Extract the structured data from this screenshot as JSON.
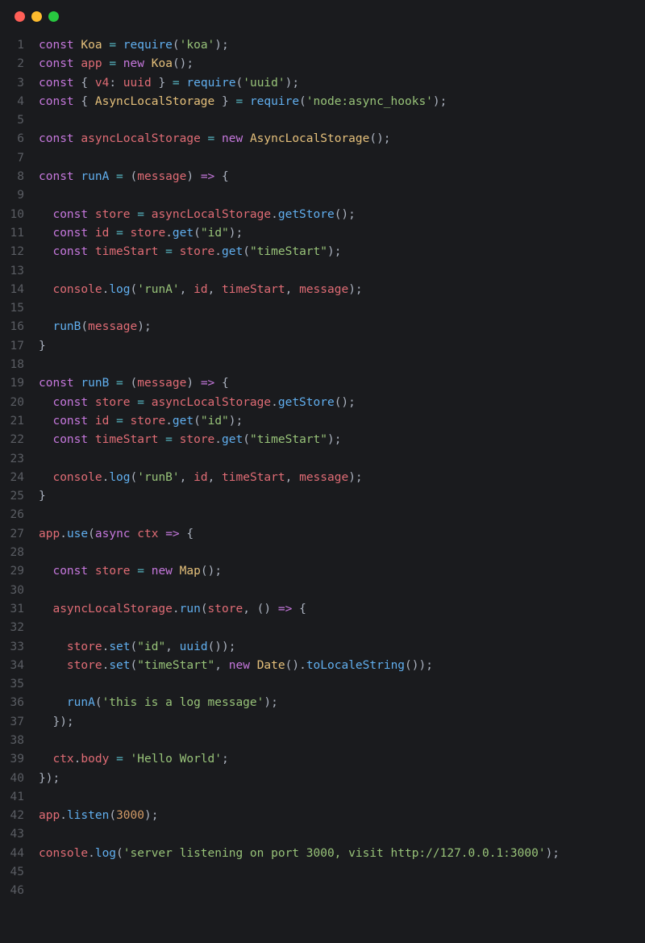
{
  "window": {
    "traffic_lights": [
      "close",
      "minimize",
      "maximize"
    ]
  },
  "line_count": 46,
  "code_lines": [
    [
      [
        "kw",
        "const"
      ],
      [
        "plain",
        " "
      ],
      [
        "cls",
        "Koa"
      ],
      [
        "plain",
        " "
      ],
      [
        "op",
        "="
      ],
      [
        "plain",
        " "
      ],
      [
        "fn",
        "require"
      ],
      [
        "punct",
        "("
      ],
      [
        "str",
        "'koa'"
      ],
      [
        "punct",
        ");"
      ]
    ],
    [
      [
        "kw",
        "const"
      ],
      [
        "plain",
        " "
      ],
      [
        "var",
        "app"
      ],
      [
        "plain",
        " "
      ],
      [
        "op",
        "="
      ],
      [
        "plain",
        " "
      ],
      [
        "kw",
        "new"
      ],
      [
        "plain",
        " "
      ],
      [
        "cls",
        "Koa"
      ],
      [
        "punct",
        "();"
      ]
    ],
    [
      [
        "kw",
        "const"
      ],
      [
        "plain",
        " "
      ],
      [
        "punct",
        "{ "
      ],
      [
        "var",
        "v4"
      ],
      [
        "punct",
        ": "
      ],
      [
        "var",
        "uuid"
      ],
      [
        "punct",
        " } "
      ],
      [
        "op",
        "="
      ],
      [
        "plain",
        " "
      ],
      [
        "fn",
        "require"
      ],
      [
        "punct",
        "("
      ],
      [
        "str",
        "'uuid'"
      ],
      [
        "punct",
        ");"
      ]
    ],
    [
      [
        "kw",
        "const"
      ],
      [
        "plain",
        " "
      ],
      [
        "punct",
        "{ "
      ],
      [
        "cls",
        "AsyncLocalStorage"
      ],
      [
        "punct",
        " } "
      ],
      [
        "op",
        "="
      ],
      [
        "plain",
        " "
      ],
      [
        "fn",
        "require"
      ],
      [
        "punct",
        "("
      ],
      [
        "str",
        "'node:async_hooks'"
      ],
      [
        "punct",
        ");"
      ]
    ],
    [],
    [
      [
        "kw",
        "const"
      ],
      [
        "plain",
        " "
      ],
      [
        "var",
        "asyncLocalStorage"
      ],
      [
        "plain",
        " "
      ],
      [
        "op",
        "="
      ],
      [
        "plain",
        " "
      ],
      [
        "kw",
        "new"
      ],
      [
        "plain",
        " "
      ],
      [
        "cls",
        "AsyncLocalStorage"
      ],
      [
        "punct",
        "();"
      ]
    ],
    [],
    [
      [
        "kw",
        "const"
      ],
      [
        "plain",
        " "
      ],
      [
        "fn",
        "runA"
      ],
      [
        "plain",
        " "
      ],
      [
        "op",
        "="
      ],
      [
        "plain",
        " "
      ],
      [
        "punct",
        "("
      ],
      [
        "var",
        "message"
      ],
      [
        "punct",
        ") "
      ],
      [
        "kw",
        "=>"
      ],
      [
        "plain",
        " "
      ],
      [
        "punct",
        "{"
      ]
    ],
    [],
    [
      [
        "plain",
        "  "
      ],
      [
        "kw",
        "const"
      ],
      [
        "plain",
        " "
      ],
      [
        "var",
        "store"
      ],
      [
        "plain",
        " "
      ],
      [
        "op",
        "="
      ],
      [
        "plain",
        " "
      ],
      [
        "var",
        "asyncLocalStorage"
      ],
      [
        "punct",
        "."
      ],
      [
        "fn",
        "getStore"
      ],
      [
        "punct",
        "();"
      ]
    ],
    [
      [
        "plain",
        "  "
      ],
      [
        "kw",
        "const"
      ],
      [
        "plain",
        " "
      ],
      [
        "var",
        "id"
      ],
      [
        "plain",
        " "
      ],
      [
        "op",
        "="
      ],
      [
        "plain",
        " "
      ],
      [
        "var",
        "store"
      ],
      [
        "punct",
        "."
      ],
      [
        "fn",
        "get"
      ],
      [
        "punct",
        "("
      ],
      [
        "str",
        "\"id\""
      ],
      [
        "punct",
        ");"
      ]
    ],
    [
      [
        "plain",
        "  "
      ],
      [
        "kw",
        "const"
      ],
      [
        "plain",
        " "
      ],
      [
        "var",
        "timeStart"
      ],
      [
        "plain",
        " "
      ],
      [
        "op",
        "="
      ],
      [
        "plain",
        " "
      ],
      [
        "var",
        "store"
      ],
      [
        "punct",
        "."
      ],
      [
        "fn",
        "get"
      ],
      [
        "punct",
        "("
      ],
      [
        "str",
        "\"timeStart\""
      ],
      [
        "punct",
        ");"
      ]
    ],
    [],
    [
      [
        "plain",
        "  "
      ],
      [
        "var",
        "console"
      ],
      [
        "punct",
        "."
      ],
      [
        "fn",
        "log"
      ],
      [
        "punct",
        "("
      ],
      [
        "str",
        "'runA'"
      ],
      [
        "punct",
        ", "
      ],
      [
        "var",
        "id"
      ],
      [
        "punct",
        ", "
      ],
      [
        "var",
        "timeStart"
      ],
      [
        "punct",
        ", "
      ],
      [
        "var",
        "message"
      ],
      [
        "punct",
        ");"
      ]
    ],
    [],
    [
      [
        "plain",
        "  "
      ],
      [
        "fn",
        "runB"
      ],
      [
        "punct",
        "("
      ],
      [
        "var",
        "message"
      ],
      [
        "punct",
        ");"
      ]
    ],
    [
      [
        "punct",
        "}"
      ]
    ],
    [],
    [
      [
        "kw",
        "const"
      ],
      [
        "plain",
        " "
      ],
      [
        "fn",
        "runB"
      ],
      [
        "plain",
        " "
      ],
      [
        "op",
        "="
      ],
      [
        "plain",
        " "
      ],
      [
        "punct",
        "("
      ],
      [
        "var",
        "message"
      ],
      [
        "punct",
        ") "
      ],
      [
        "kw",
        "=>"
      ],
      [
        "plain",
        " "
      ],
      [
        "punct",
        "{"
      ]
    ],
    [
      [
        "plain",
        "  "
      ],
      [
        "kw",
        "const"
      ],
      [
        "plain",
        " "
      ],
      [
        "var",
        "store"
      ],
      [
        "plain",
        " "
      ],
      [
        "op",
        "="
      ],
      [
        "plain",
        " "
      ],
      [
        "var",
        "asyncLocalStorage"
      ],
      [
        "punct",
        "."
      ],
      [
        "fn",
        "getStore"
      ],
      [
        "punct",
        "();"
      ]
    ],
    [
      [
        "plain",
        "  "
      ],
      [
        "kw",
        "const"
      ],
      [
        "plain",
        " "
      ],
      [
        "var",
        "id"
      ],
      [
        "plain",
        " "
      ],
      [
        "op",
        "="
      ],
      [
        "plain",
        " "
      ],
      [
        "var",
        "store"
      ],
      [
        "punct",
        "."
      ],
      [
        "fn",
        "get"
      ],
      [
        "punct",
        "("
      ],
      [
        "str",
        "\"id\""
      ],
      [
        "punct",
        ");"
      ]
    ],
    [
      [
        "plain",
        "  "
      ],
      [
        "kw",
        "const"
      ],
      [
        "plain",
        " "
      ],
      [
        "var",
        "timeStart"
      ],
      [
        "plain",
        " "
      ],
      [
        "op",
        "="
      ],
      [
        "plain",
        " "
      ],
      [
        "var",
        "store"
      ],
      [
        "punct",
        "."
      ],
      [
        "fn",
        "get"
      ],
      [
        "punct",
        "("
      ],
      [
        "str",
        "\"timeStart\""
      ],
      [
        "punct",
        ");"
      ]
    ],
    [],
    [
      [
        "plain",
        "  "
      ],
      [
        "var",
        "console"
      ],
      [
        "punct",
        "."
      ],
      [
        "fn",
        "log"
      ],
      [
        "punct",
        "("
      ],
      [
        "str",
        "'runB'"
      ],
      [
        "punct",
        ", "
      ],
      [
        "var",
        "id"
      ],
      [
        "punct",
        ", "
      ],
      [
        "var",
        "timeStart"
      ],
      [
        "punct",
        ", "
      ],
      [
        "var",
        "message"
      ],
      [
        "punct",
        ");"
      ]
    ],
    [
      [
        "punct",
        "}"
      ]
    ],
    [],
    [
      [
        "var",
        "app"
      ],
      [
        "punct",
        "."
      ],
      [
        "fn",
        "use"
      ],
      [
        "punct",
        "("
      ],
      [
        "kw",
        "async"
      ],
      [
        "plain",
        " "
      ],
      [
        "var",
        "ctx"
      ],
      [
        "plain",
        " "
      ],
      [
        "kw",
        "=>"
      ],
      [
        "plain",
        " "
      ],
      [
        "punct",
        "{"
      ]
    ],
    [],
    [
      [
        "plain",
        "  "
      ],
      [
        "kw",
        "const"
      ],
      [
        "plain",
        " "
      ],
      [
        "var",
        "store"
      ],
      [
        "plain",
        " "
      ],
      [
        "op",
        "="
      ],
      [
        "plain",
        " "
      ],
      [
        "kw",
        "new"
      ],
      [
        "plain",
        " "
      ],
      [
        "cls",
        "Map"
      ],
      [
        "punct",
        "();"
      ]
    ],
    [],
    [
      [
        "plain",
        "  "
      ],
      [
        "var",
        "asyncLocalStorage"
      ],
      [
        "punct",
        "."
      ],
      [
        "fn",
        "run"
      ],
      [
        "punct",
        "("
      ],
      [
        "var",
        "store"
      ],
      [
        "punct",
        ", () "
      ],
      [
        "kw",
        "=>"
      ],
      [
        "plain",
        " "
      ],
      [
        "punct",
        "{"
      ]
    ],
    [],
    [
      [
        "plain",
        "    "
      ],
      [
        "var",
        "store"
      ],
      [
        "punct",
        "."
      ],
      [
        "fn",
        "set"
      ],
      [
        "punct",
        "("
      ],
      [
        "str",
        "\"id\""
      ],
      [
        "punct",
        ", "
      ],
      [
        "fn",
        "uuid"
      ],
      [
        "punct",
        "());"
      ]
    ],
    [
      [
        "plain",
        "    "
      ],
      [
        "var",
        "store"
      ],
      [
        "punct",
        "."
      ],
      [
        "fn",
        "set"
      ],
      [
        "punct",
        "("
      ],
      [
        "str",
        "\"timeStart\""
      ],
      [
        "punct",
        ", "
      ],
      [
        "kw",
        "new"
      ],
      [
        "plain",
        " "
      ],
      [
        "cls",
        "Date"
      ],
      [
        "punct",
        "()."
      ],
      [
        "fn",
        "toLocaleString"
      ],
      [
        "punct",
        "());"
      ]
    ],
    [],
    [
      [
        "plain",
        "    "
      ],
      [
        "fn",
        "runA"
      ],
      [
        "punct",
        "("
      ],
      [
        "str",
        "'this is a log message'"
      ],
      [
        "punct",
        ");"
      ]
    ],
    [
      [
        "plain",
        "  "
      ],
      [
        "punct",
        "});"
      ]
    ],
    [],
    [
      [
        "plain",
        "  "
      ],
      [
        "var",
        "ctx"
      ],
      [
        "punct",
        "."
      ],
      [
        "prop",
        "body"
      ],
      [
        "plain",
        " "
      ],
      [
        "op",
        "="
      ],
      [
        "plain",
        " "
      ],
      [
        "str",
        "'Hello World'"
      ],
      [
        "punct",
        ";"
      ]
    ],
    [
      [
        "punct",
        "});"
      ]
    ],
    [],
    [
      [
        "var",
        "app"
      ],
      [
        "punct",
        "."
      ],
      [
        "fn",
        "listen"
      ],
      [
        "punct",
        "("
      ],
      [
        "num",
        "3000"
      ],
      [
        "punct",
        ");"
      ]
    ],
    [],
    [
      [
        "var",
        "console"
      ],
      [
        "punct",
        "."
      ],
      [
        "fn",
        "log"
      ],
      [
        "punct",
        "("
      ],
      [
        "str",
        "'server listening on port 3000, visit http://127.0.0.1:3000'"
      ],
      [
        "punct",
        ");"
      ]
    ],
    [],
    []
  ]
}
